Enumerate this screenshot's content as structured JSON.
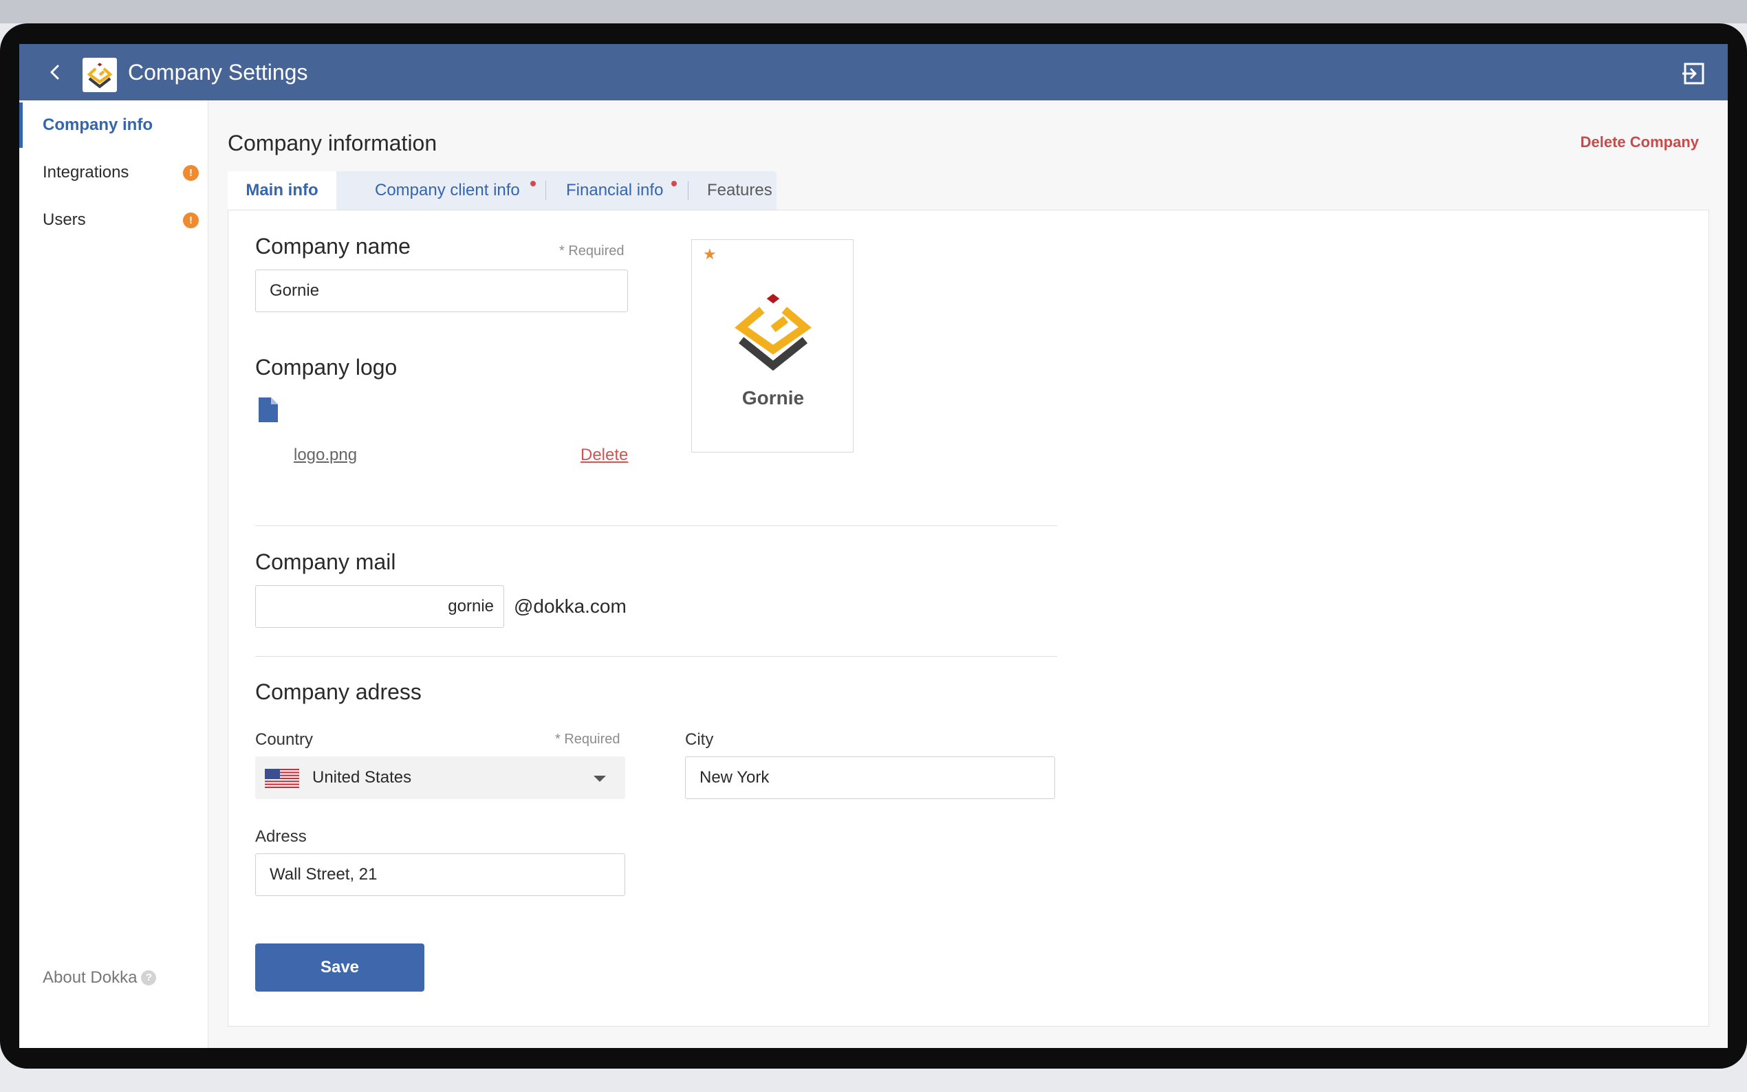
{
  "header": {
    "title": "Company Settings",
    "back_icon": "chevron-left-icon",
    "logout_icon": "logout-icon",
    "background": "#466496"
  },
  "sidebar": {
    "items": [
      {
        "label": "Company info",
        "active": true,
        "warning": false
      },
      {
        "label": "Integrations",
        "active": false,
        "warning": true,
        "badge": "!"
      },
      {
        "label": "Users",
        "active": false,
        "warning": true,
        "badge": "!"
      }
    ],
    "about_label": "About Dokka",
    "help_icon": "?",
    "accent": "#3565ad",
    "warning_color": "#f08a2e"
  },
  "main": {
    "title": "Company information",
    "delete_company_label": "Delete Company",
    "tabs": [
      {
        "label": "Main info",
        "active": true,
        "has_dot": false
      },
      {
        "label": "Company client info",
        "active": false,
        "has_dot": true
      },
      {
        "label": "Financial info",
        "active": false,
        "has_dot": true
      },
      {
        "label": "Features",
        "active": false,
        "has_dot": false
      }
    ]
  },
  "form": {
    "company_name": {
      "title": "Company name",
      "required_label": "* Required",
      "value": "Gornie"
    },
    "company_logo": {
      "title": "Company logo",
      "file_name": "logo.png",
      "delete_label": "Delete",
      "preview_name": "Gornie"
    },
    "company_mail": {
      "title": "Company mail",
      "value": "gornie",
      "domain": "@dokka.com"
    },
    "company_address": {
      "title": "Company adress",
      "country": {
        "label": "Country",
        "required_label": "* Required",
        "value": "United States"
      },
      "city": {
        "label": "City",
        "value": "New York"
      },
      "address": {
        "label": "Adress",
        "value": "Wall Street, 21"
      }
    },
    "save_label": "Save"
  }
}
